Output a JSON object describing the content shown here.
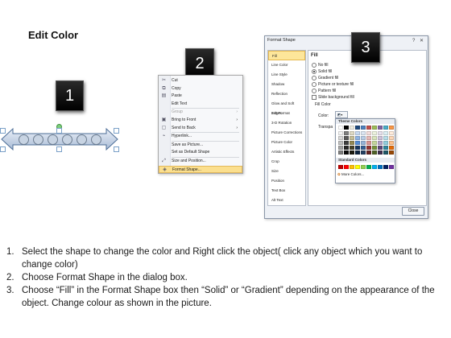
{
  "title": "Edit Color",
  "badges": [
    "1",
    "2",
    "3"
  ],
  "context_menu": {
    "items": [
      {
        "label": "Cut",
        "icon": "scissors-icon",
        "glyph": "✂",
        "disabled": false,
        "arrow": ""
      },
      {
        "label": "Copy",
        "icon": "copy-icon",
        "glyph": "⧉",
        "disabled": false,
        "arrow": ""
      },
      {
        "label": "Paste",
        "icon": "paste-icon",
        "glyph": "▤",
        "disabled": false,
        "arrow": ""
      },
      {
        "label": "Edit Text",
        "icon": "edit-text-icon",
        "glyph": "",
        "disabled": false,
        "arrow": ""
      },
      {
        "label": "Group",
        "icon": "group-icon",
        "glyph": "",
        "disabled": true,
        "arrow": "›"
      },
      {
        "label": "Bring to Front",
        "icon": "bring-front-icon",
        "glyph": "▣",
        "disabled": false,
        "arrow": "›"
      },
      {
        "label": "Send to Back",
        "icon": "send-back-icon",
        "glyph": "▢",
        "disabled": false,
        "arrow": "›"
      },
      {
        "label": "Hyperlink...",
        "icon": "hyperlink-icon",
        "glyph": "⌁",
        "disabled": false,
        "arrow": ""
      },
      {
        "label": "Save as Picture...",
        "icon": "save-picture-icon",
        "glyph": "",
        "disabled": false,
        "arrow": ""
      },
      {
        "label": "Set as Default Shape",
        "icon": "default-shape-icon",
        "glyph": "",
        "disabled": false,
        "arrow": ""
      },
      {
        "label": "Size and Position...",
        "icon": "size-position-icon",
        "glyph": "⤢",
        "disabled": false,
        "arrow": ""
      },
      {
        "label": "Format Shape...",
        "icon": "format-shape-icon",
        "glyph": "◈",
        "disabled": false,
        "arrow": ""
      }
    ],
    "highlighted_index": 11
  },
  "dialog": {
    "title": "Format Shape",
    "title_buttons": "? ✕",
    "categories": [
      "Fill",
      "Line Color",
      "Line Style",
      "Shadow",
      "Reflection",
      "Glow and Soft Edges",
      "3-D Format",
      "3-D Rotation",
      "Picture Corrections",
      "Picture Color",
      "Artistic Effects",
      "Crop",
      "Size",
      "Position",
      "Text Box",
      "Alt Text"
    ],
    "selected_category": "Fill",
    "section_title": "Fill",
    "fill_options": [
      {
        "label": "No fill",
        "selected": false
      },
      {
        "label": "Solid fill",
        "selected": true
      },
      {
        "label": "Gradient fill",
        "selected": false
      },
      {
        "label": "Picture or texture fill",
        "selected": false
      },
      {
        "label": "Pattern fill",
        "selected": false
      }
    ],
    "slide_background": "Slide background fill",
    "fill_color_label": "Fill Color",
    "color_label": "Color:",
    "transparency_label": "Transpa",
    "close_label": "Close",
    "color_popup": {
      "theme_title": "Theme Colors",
      "standard_title": "Standard Colors",
      "more_colors": "More Colors...",
      "theme_top": [
        "#ffffff",
        "#000000",
        "#eeece1",
        "#1f497d",
        "#4f81bd",
        "#c0504d",
        "#9bbb59",
        "#8064a2",
        "#4bacc6",
        "#f79646"
      ],
      "theme_shades": [
        [
          "#f2f2f2",
          "#7f7f7f",
          "#ddd9c3",
          "#c6d9f0",
          "#dbe5f1",
          "#f2dcdb",
          "#ebf1dd",
          "#e5e0ec",
          "#dbeef3",
          "#fdeada"
        ],
        [
          "#d8d8d8",
          "#595959",
          "#c4bd97",
          "#8db3e2",
          "#b8cce4",
          "#e5b9b7",
          "#d7e3bc",
          "#ccc1d9",
          "#b7dde8",
          "#fbd5b5"
        ],
        [
          "#bfbfbf",
          "#3f3f3f",
          "#938953",
          "#548dd4",
          "#95b3d7",
          "#d99694",
          "#c3d69b",
          "#b2a2c7",
          "#92cddc",
          "#fac08f"
        ],
        [
          "#a5a5a5",
          "#262626",
          "#494429",
          "#17365d",
          "#366092",
          "#953734",
          "#76923c",
          "#5f497a",
          "#31859b",
          "#e36c09"
        ],
        [
          "#7f7f7f",
          "#0c0c0c",
          "#1d1b10",
          "#0f243e",
          "#244061",
          "#632423",
          "#4f6128",
          "#3f3151",
          "#205867",
          "#974806"
        ]
      ],
      "standard": [
        "#c00000",
        "#ff0000",
        "#ffc000",
        "#ffff00",
        "#92d050",
        "#00b050",
        "#00b0f0",
        "#0070c0",
        "#002060",
        "#7030a0"
      ]
    }
  },
  "instructions": [
    {
      "num": "1.",
      "text": "Select the shape to change the color and Right click the object( click any object which you want to change color)"
    },
    {
      "num": "2.",
      "text": "Choose Format Shape in the dialog box."
    },
    {
      "num": "3.",
      "text": "Choose “Fill” in the Format Shape box then “Solid” or “Gradient” depending on the appearance of the object. Change colour as shown in the picture."
    }
  ],
  "colors": {
    "arrow_fill": "#c5d3e6",
    "arrow_stroke": "#4b6c96",
    "menu_highlight": "#fbdf8e",
    "badge_bg": "#000000"
  }
}
